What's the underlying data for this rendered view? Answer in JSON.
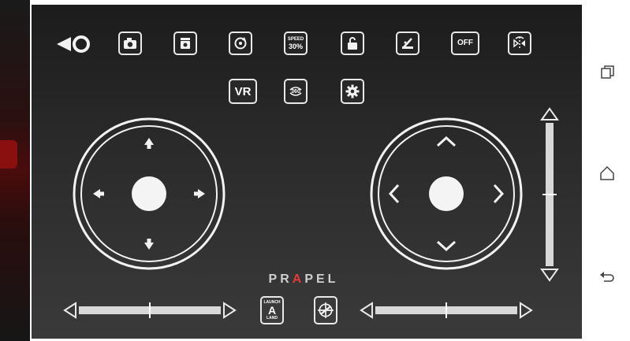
{
  "toolbar": {
    "speed_line1": "SPEED",
    "speed_line2": "30%",
    "off_label": "OFF",
    "vr_label": "VR",
    "rotate_label": "360"
  },
  "bottom": {
    "brand_pre": "PR",
    "brand_mid": "A",
    "brand_post": "PEL",
    "mode_top": "LAUNCH",
    "mode_letter": "A",
    "mode_bottom": "LAND"
  },
  "icons": {
    "back": "back-arrow-icon",
    "camera": "camera-icon",
    "video": "video-record-icon",
    "rotate": "rotate-icon",
    "lock": "unlock-icon",
    "calibrate": "calibrate-icon",
    "flip": "flip-icon",
    "settings": "gear-icon",
    "launch": "launch-land-icon",
    "trim": "trim-compass-icon"
  },
  "colors": {
    "screen_bg": "#2b2b2b",
    "foreground": "#f2f2f2",
    "brand_accent": "#e03a3a"
  }
}
